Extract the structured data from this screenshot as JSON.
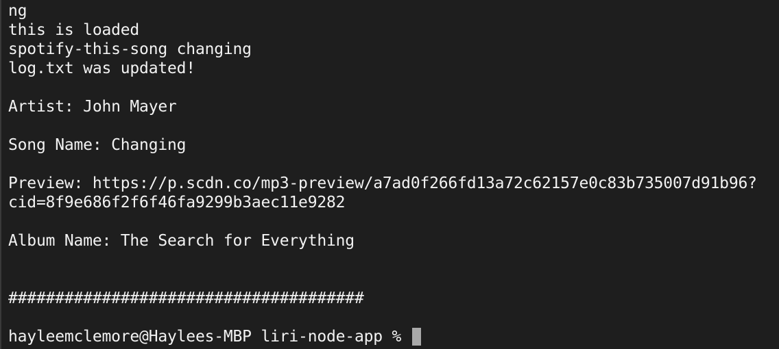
{
  "terminal": {
    "lines": [
      "ng",
      "this is loaded",
      "spotify-this-song changing",
      "log.txt was updated!",
      "",
      "Artist: John Mayer",
      "",
      "Song Name: Changing",
      "",
      "Preview: https://p.scdn.co/mp3-preview/a7ad0f266fd13a72c62157e0c83b735007d91b96?",
      "cid=8f9e686f2f6f46fa9299b3aec11e9282",
      "",
      "Album Name: The Search for Everything",
      "",
      "",
      "######################################",
      ""
    ],
    "prompt": "hayleemclemore@Haylees-MBP liri-node-app % "
  }
}
